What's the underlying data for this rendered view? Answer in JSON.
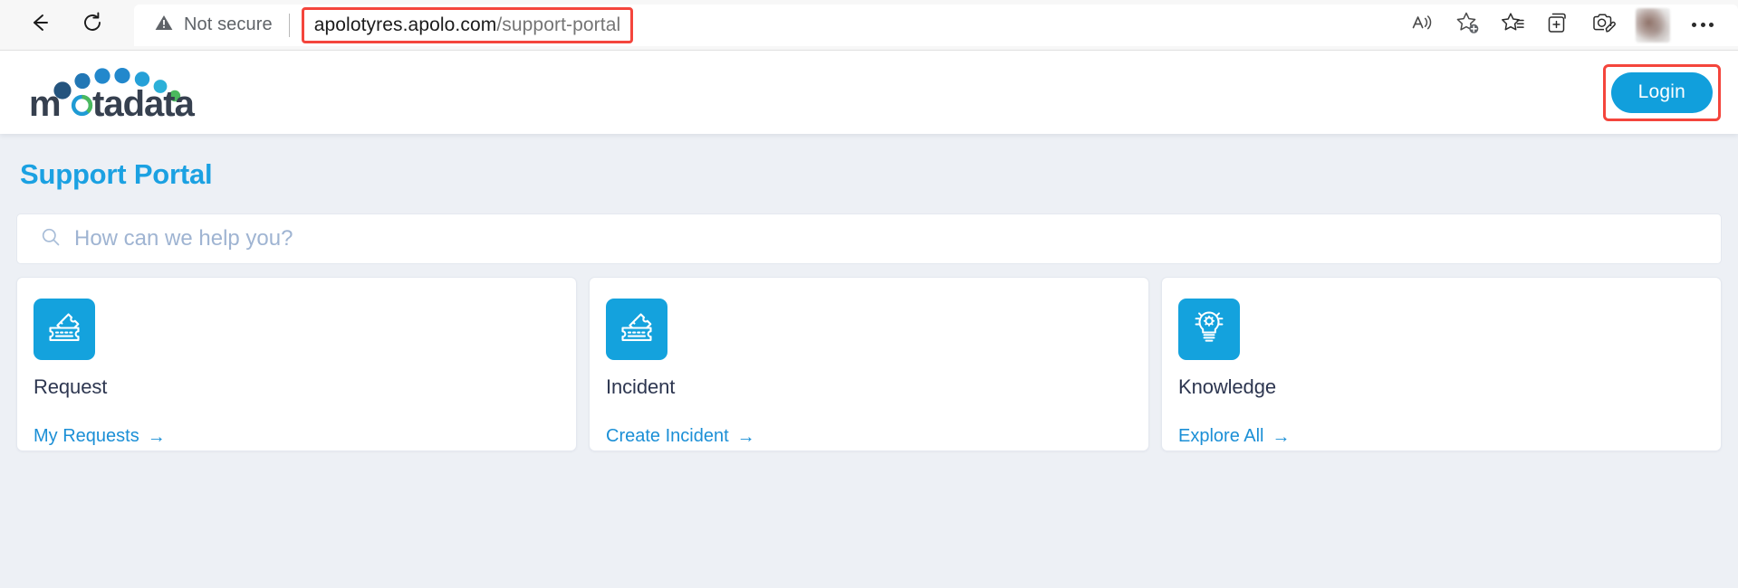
{
  "browser": {
    "back_icon": "back-arrow-icon",
    "reload_icon": "reload-icon",
    "security_label": "Not secure",
    "url_domain": "apolotyres.apolo.com",
    "url_path": "/support-portal",
    "toolbar_icons": [
      "read-aloud-icon",
      "add-favorite-icon",
      "favorites-icon",
      "collections-icon",
      "screenshot-icon"
    ],
    "avatar": "profile-avatar",
    "more_label": "settings-and-more-icon",
    "annotation_color": "#f4453c"
  },
  "site_header": {
    "logo_text": "motadata",
    "logo_dot_colors": [
      "#24547e",
      "#2277b5",
      "#2288cc",
      "#25a0d8",
      "#2cb0d8",
      "#3bbcad",
      "#4bb95e"
    ],
    "login_label": "Login",
    "login_color": "#119fdc"
  },
  "main": {
    "page_title": "Support Portal",
    "page_title_color": "#1ba1e2",
    "search": {
      "icon": "search-icon",
      "placeholder": "How can we help you?",
      "value": ""
    },
    "cards": [
      {
        "icon": "ticket-icon",
        "title": "Request",
        "link_label": "My Requests",
        "link_arrow": "→"
      },
      {
        "icon": "ticket-icon",
        "title": "Incident",
        "link_label": "Create Incident",
        "link_arrow": "→"
      },
      {
        "icon": "lightbulb-gear-icon",
        "title": "Knowledge",
        "link_label": "Explore All",
        "link_arrow": "→"
      }
    ]
  }
}
